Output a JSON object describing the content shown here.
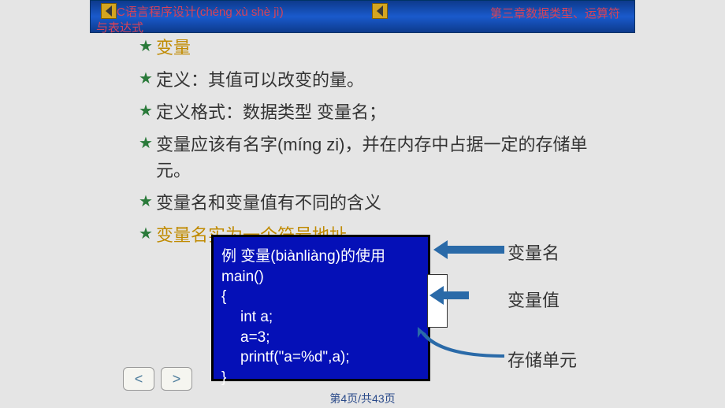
{
  "header": {
    "title_left": "C语言程序设计(chéng xù shè jì)",
    "title_left_line2": "与表达式",
    "title_right": "第三章数据类型、运算符"
  },
  "content": {
    "title": "变量",
    "bullets": [
      "定义：其值可以改变的量。",
      "定义格式：数据类型    变量名；",
      "变量应该有名字(míng zi)，并在内存中占据一定的存储单元。",
      "变量名和变量值有不同的含义",
      "变量名实为一个符号地址"
    ]
  },
  "code": {
    "line1": "例    变量(biànliàng)的使用",
    "line2": "main()",
    "line3": "{",
    "line4": "int a;",
    "line5": "a=3;",
    "line6": "printf(\"a=%d\",a);",
    "line7": "}"
  },
  "labels": {
    "l1": "变量名",
    "l2": "变量值",
    "l3": "存储单元"
  },
  "nav": {
    "prev": "<",
    "next": ">"
  },
  "footer": {
    "page": "第4页/共43页"
  }
}
